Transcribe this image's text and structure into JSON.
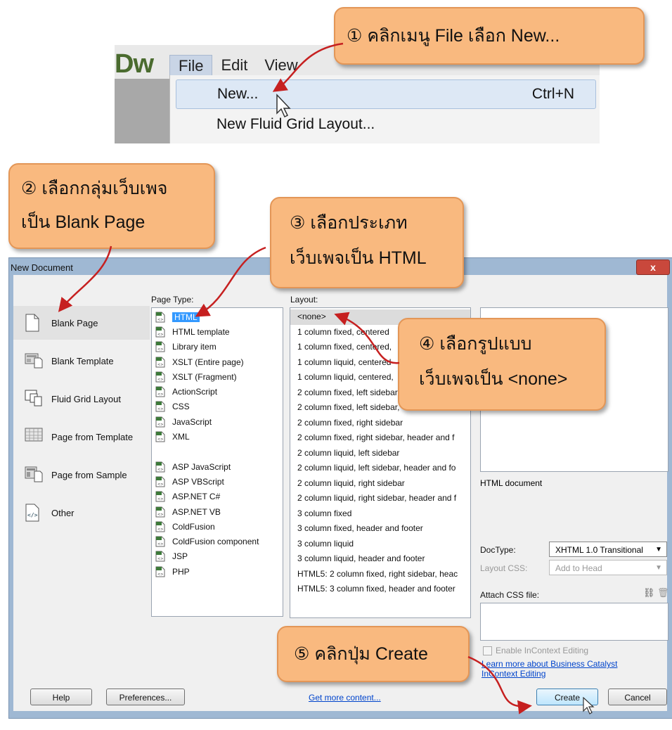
{
  "menu": {
    "logo": "Dw",
    "menubar": [
      "File",
      "Edit",
      "View"
    ],
    "items": [
      {
        "label": "New...",
        "shortcut": "Ctrl+N"
      },
      {
        "label": "New Fluid Grid Layout...",
        "shortcut": ""
      }
    ]
  },
  "callouts": {
    "c1": {
      "line1": "① คลิกเมนู File เลือก New..."
    },
    "c2": {
      "line1": "② เลือกกลุ่มเว็บเพจ",
      "line2": "เป็น Blank Page"
    },
    "c3": {
      "line1": "③ เลือกประเภท",
      "line2": "เว็บเพจเป็น HTML"
    },
    "c4": {
      "line1": "④ เลือกรูปแบบ",
      "line2": "เว็บเพจเป็น <none>"
    },
    "c5": {
      "line1": "⑤ คลิกปุ่ม Create"
    }
  },
  "dialog": {
    "title": "New Document",
    "close": "x",
    "categories": [
      "Blank Page",
      "Blank Template",
      "Fluid Grid Layout",
      "Page from Template",
      "Page from Sample",
      "Other"
    ],
    "page_type_label": "Page Type:",
    "page_types": [
      "HTML",
      "HTML template",
      "Library item",
      "XSLT (Entire page)",
      "XSLT (Fragment)",
      "ActionScript",
      "CSS",
      "JavaScript",
      "XML",
      "",
      "ASP JavaScript",
      "ASP VBScript",
      "ASP.NET C#",
      "ASP.NET VB",
      "ColdFusion",
      "ColdFusion component",
      "JSP",
      "PHP"
    ],
    "layout_label": "Layout:",
    "layouts": [
      "<none>",
      "1 column fixed, centered",
      "1 column fixed, centered,",
      "1 column liquid, centered",
      "1 column liquid, centered,",
      "2 column fixed, left sidebar",
      "2 column fixed, left sidebar,",
      "2 column fixed, right sidebar",
      "2 column fixed, right sidebar, header and f",
      "2 column liquid, left sidebar",
      "2 column liquid, left sidebar, header and fo",
      "2 column liquid, right sidebar",
      "2 column liquid, right sidebar, header and f",
      "3 column fixed",
      "3 column fixed, header and footer",
      "3 column liquid",
      "3 column liquid, header and footer",
      "HTML5: 2 column fixed, right sidebar, heac",
      "HTML5: 3 column fixed, header and footer"
    ],
    "preview_desc": "HTML document",
    "doctype_label": "DocType:",
    "doctype_value": "XHTML 1.0 Transitional",
    "layout_css_label": "Layout CSS:",
    "layout_css_value": "Add to Head",
    "attach_css_label": "Attach CSS file:",
    "enable_incontext": "Enable InContext Editing",
    "learn_more_1": "Learn more about Business Catalyst",
    "learn_more_2": "InContext Editing",
    "help": "Help",
    "preferences": "Preferences...",
    "get_more": "Get more content...",
    "create": "Create",
    "cancel": "Cancel"
  }
}
